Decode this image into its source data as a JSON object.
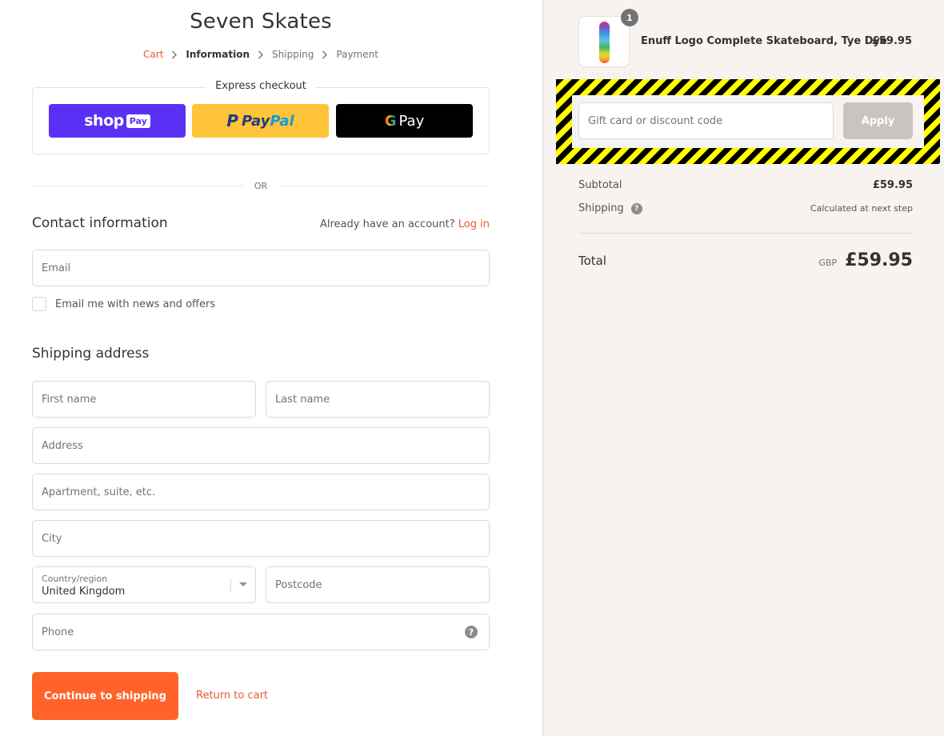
{
  "shop": {
    "title": "Seven Skates"
  },
  "breadcrumb": [
    {
      "label": "Cart",
      "state": "link"
    },
    {
      "label": "Information",
      "state": "current"
    },
    {
      "label": "Shipping",
      "state": "upcoming"
    },
    {
      "label": "Payment",
      "state": "upcoming"
    }
  ],
  "express_checkout": {
    "legend": "Express checkout",
    "shop_pay": {
      "word": "shop",
      "badge": "Pay"
    },
    "paypal": {
      "pay": "Pay",
      "pal": "Pal"
    },
    "gpay": {
      "g": "G",
      "pay": "Pay"
    }
  },
  "or_divider": "OR",
  "contact": {
    "title": "Contact information",
    "account_prompt": "Already have an account?",
    "login_link": "Log in",
    "email_placeholder": "Email",
    "newsletter_label": "Email me with news and offers"
  },
  "shipping": {
    "title": "Shipping address",
    "first_name_placeholder": "First name",
    "last_name_placeholder": "Last name",
    "address_placeholder": "Address",
    "apartment_placeholder": "Apartment, suite, etc.",
    "city_placeholder": "City",
    "country_label": "Country/region",
    "country_value": "United Kingdom",
    "postcode_placeholder": "Postcode",
    "phone_placeholder": "Phone",
    "help_glyph": "?"
  },
  "actions": {
    "continue_label": "Continue to shipping",
    "return_label": "Return to cart"
  },
  "order_summary": {
    "product": {
      "name": "Enuff Logo Complete Skateboard, Tye Dye",
      "price": "£59.95",
      "quantity": "1"
    },
    "discount_placeholder": "Gift card or discount code",
    "apply_label": "Apply",
    "subtotal_label": "Subtotal",
    "subtotal_value": "£59.95",
    "shipping_label": "Shipping",
    "shipping_value": "Calculated at next step",
    "help_glyph": "?",
    "total_label": "Total",
    "total_currency": "GBP",
    "total_value": "£59.95"
  },
  "colors": {
    "accent": "#e8582e",
    "primary_button": "#ff6329",
    "shop_pay": "#5a31f4",
    "paypal": "#ffc439",
    "gpay": "#000000",
    "sidebar_bg": "#f7f3f0",
    "hazard_yellow": "#ffff00",
    "hazard_black": "#000000"
  }
}
